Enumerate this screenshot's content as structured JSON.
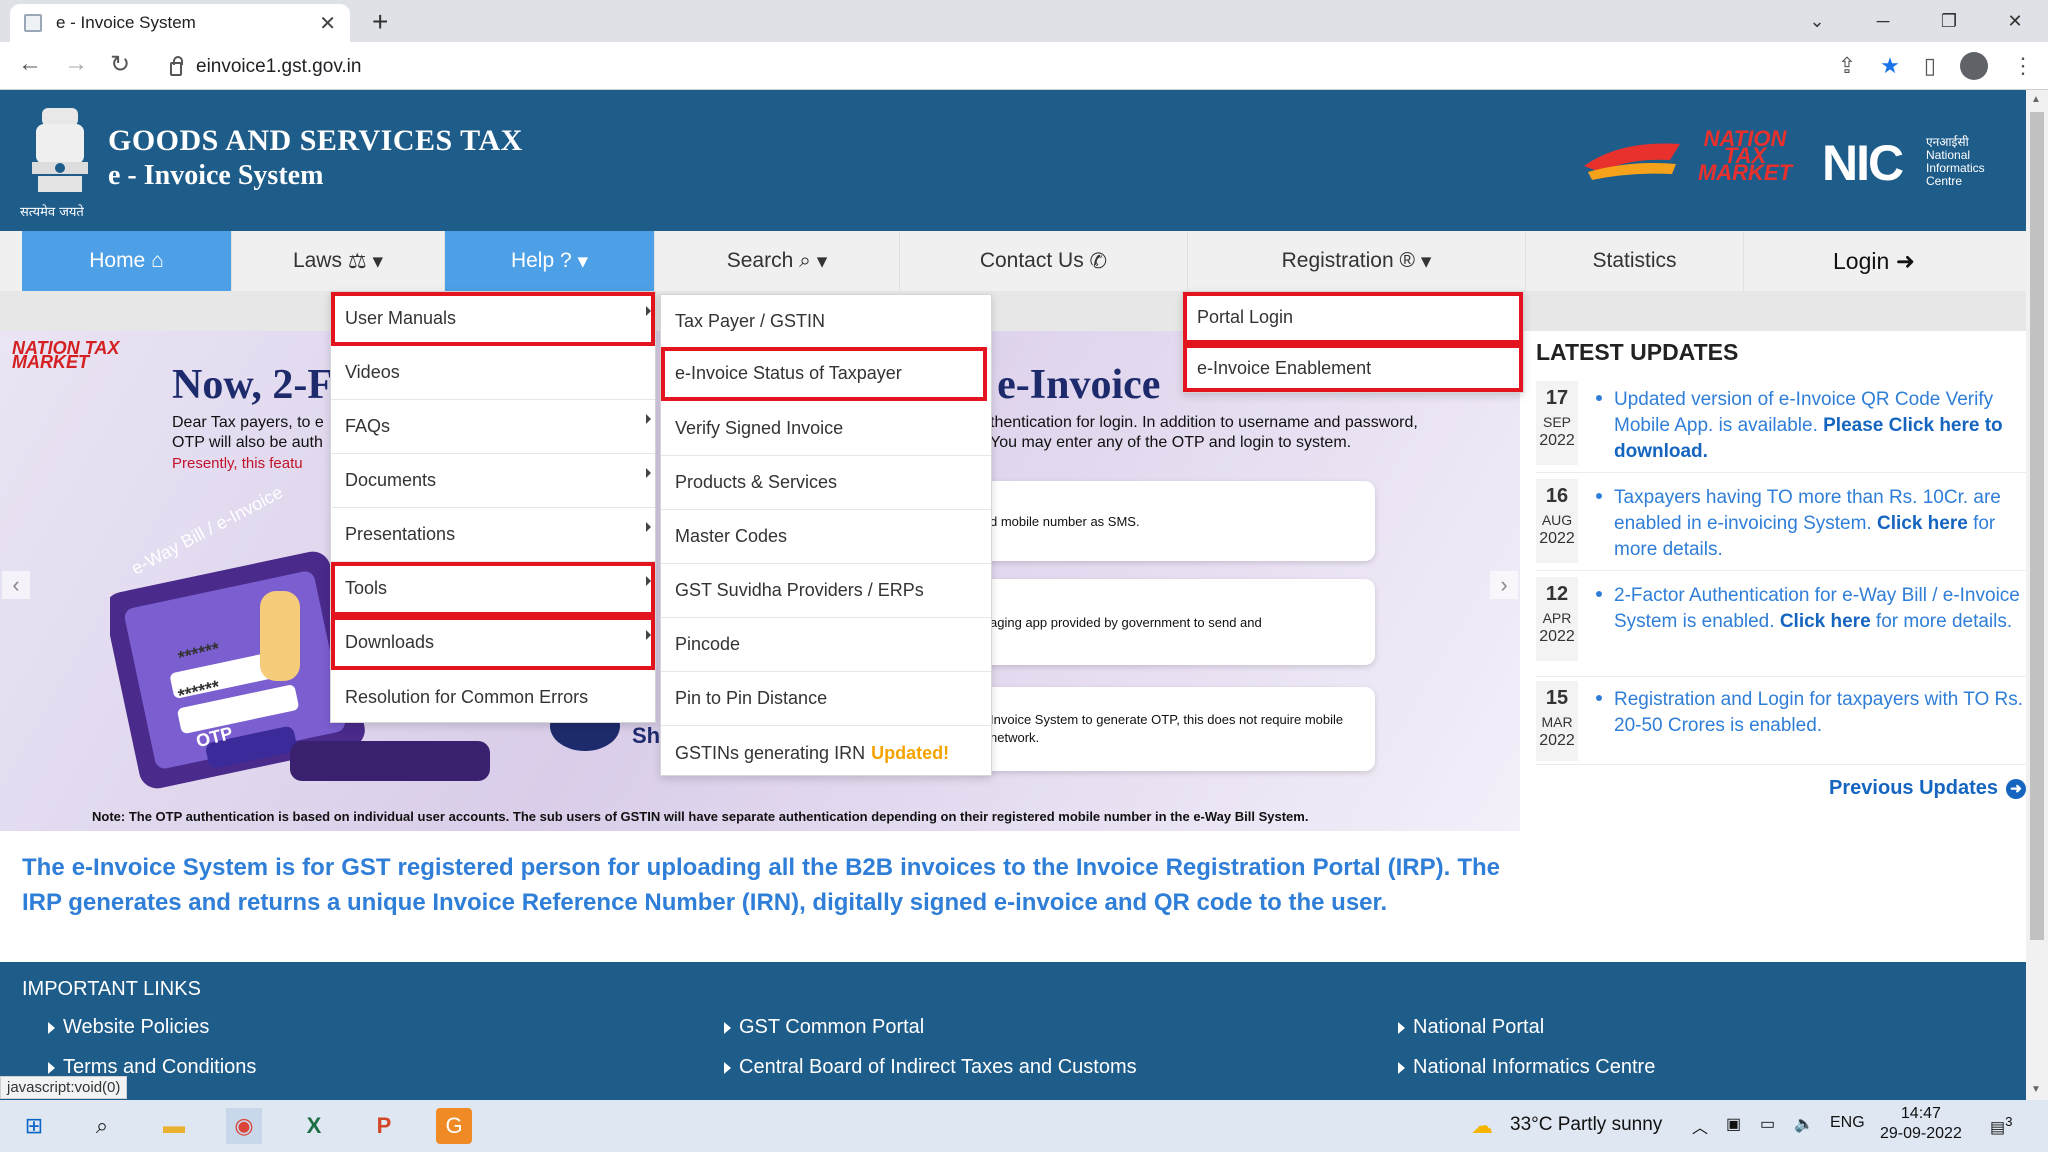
{
  "browser": {
    "tab_title": "e - Invoice System",
    "url": "einvoice1.gst.gov.in"
  },
  "header": {
    "emblem_caption": "सत्यमेव जयते",
    "title_line1": "GOODS AND SERVICES TAX",
    "title_line2": "e - Invoice System",
    "partner_logo_text": "NATION TAX MARKET",
    "nic_logo": "NIC",
    "nic_sub": "एनआईसी National Informatics Centre"
  },
  "nav": {
    "home": "Home",
    "laws": "Laws",
    "help": "Help",
    "search": "Search",
    "contact": "Contact Us",
    "registration": "Registration",
    "statistics": "Statistics",
    "login": "Login"
  },
  "help_menu": [
    {
      "label": "User Manuals",
      "has_sub": true,
      "highlighted": true
    },
    {
      "label": "Videos",
      "has_sub": false,
      "highlighted": false
    },
    {
      "label": "FAQs",
      "has_sub": true,
      "highlighted": false
    },
    {
      "label": "Documents",
      "has_sub": true,
      "highlighted": false
    },
    {
      "label": "Presentations",
      "has_sub": true,
      "highlighted": false
    },
    {
      "label": "Tools",
      "has_sub": true,
      "highlighted": true
    },
    {
      "label": "Downloads",
      "has_sub": true,
      "highlighted": true
    },
    {
      "label": "Resolution for Common Errors",
      "has_sub": false,
      "highlighted": false
    }
  ],
  "search_menu": [
    {
      "label": "Tax Payer / GSTIN",
      "highlighted": false
    },
    {
      "label": "e-Invoice Status of Taxpayer",
      "highlighted": true
    },
    {
      "label": "Verify Signed Invoice",
      "highlighted": false
    },
    {
      "label": "Products & Services",
      "highlighted": false
    },
    {
      "label": "Master Codes",
      "highlighted": false
    },
    {
      "label": "GST Suvidha Providers / ERPs",
      "highlighted": false
    },
    {
      "label": "Pincode",
      "highlighted": false
    },
    {
      "label": "Pin to Pin Distance",
      "highlighted": false
    },
    {
      "label": "GSTINs generating IRN",
      "highlighted": false,
      "badge": "Updated!"
    }
  ],
  "registration_menu": [
    {
      "label": "Portal Login",
      "highlighted": true
    },
    {
      "label": "e-Invoice Enablement",
      "highlighted": true
    }
  ],
  "banner": {
    "logo_text": "NATION TAX MARKET",
    "headline_left": "Now, 2-F",
    "headline_right": "/ e-Invoice",
    "text_left_1": "Dear Tax payers, to e",
    "text_left_2": "OTP will also be auth",
    "text_red": "Presently, this featu",
    "text_right_1": "thentication for login. In addition to username and password,",
    "text_right_2": "You may enter any of the OTP and login to system.",
    "card1": "d mobile number as SMS.",
    "card2": "aging app provided by government to send and",
    "card3": "Invoice System to generate OTP,  this does not require mobile network.",
    "sh_text": "Sh",
    "screen_text": "e-Way Bill / e-Invoice",
    "pwd_mask": "******",
    "otp_label": "OTP",
    "note": "Note: The OTP authentication is based on individual user accounts.  The sub users of GSTIN will have separate authentication depending on their registered mobile number in the e-Way Bill System."
  },
  "info_paragraph": "The e-Invoice System is for GST registered person for uploading all the B2B invoices to the Invoice Registration Portal (IRP). The IRP generates and returns a unique Invoice Reference Number (IRN), digitally signed e-invoice and QR code to the user.",
  "latest_updates": {
    "title": "LATEST UPDATES",
    "items": [
      {
        "day": "17",
        "month": "SEP",
        "year": "2022",
        "text": "Updated version of e-Invoice QR Code Verify Mobile App. is available. ",
        "link": "Please Click here to download.",
        "after": ""
      },
      {
        "day": "16",
        "month": "AUG",
        "year": "2022",
        "text": "Taxpayers having TO more than Rs. 10Cr. are enabled in e-invoicing System. ",
        "link": "Click here",
        "after": " for more details."
      },
      {
        "day": "12",
        "month": "APR",
        "year": "2022",
        "text": "2-Factor Authentication for e-Way Bill / e-Invoice System is enabled. ",
        "link": "Click here",
        "after": " for more details."
      },
      {
        "day": "15",
        "month": "MAR",
        "year": "2022",
        "text": "Registration and Login for taxpayers with TO Rs. 20-50 Crores is enabled.",
        "link": "",
        "after": ""
      }
    ],
    "previous": "Previous Updates"
  },
  "footer": {
    "title": "IMPORTANT LINKS",
    "col1": [
      "Website Policies",
      "Terms and Conditions"
    ],
    "col2": [
      "GST Common Portal",
      "Central Board of Indirect Taxes and Customs"
    ],
    "col3": [
      "National Portal",
      "National Informatics Centre"
    ]
  },
  "status_bar": "javascript:void(0)",
  "taskbar": {
    "weather": "33°C  Partly sunny",
    "language": "ENG",
    "time": "14:47",
    "date": "29-09-2022",
    "notifications": "3"
  },
  "colors": {
    "header_blue": "#1e5c8a",
    "nav_active": "#4da0e6",
    "highlight_red": "#e3141d",
    "link_blue": "#2f7ed8",
    "updated_badge": "#f5a300"
  }
}
